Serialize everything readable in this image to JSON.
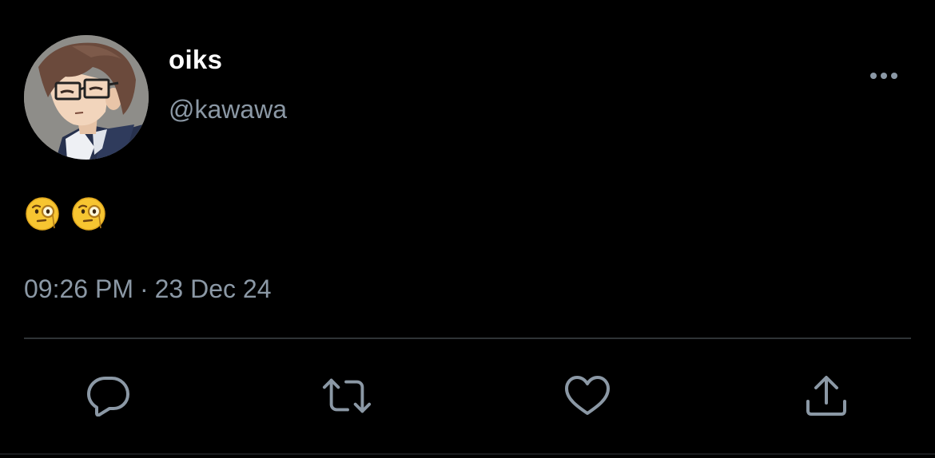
{
  "tweet": {
    "author": {
      "display_name": "oiks",
      "handle": "@kawawa"
    },
    "body": {
      "emojis": [
        "face-with-monocle",
        "face-with-monocle"
      ]
    },
    "meta": {
      "time": "09:26 PM",
      "separator": "·",
      "date": "23 Dec 24"
    },
    "actions": [
      {
        "name": "reply",
        "icon": "reply-icon"
      },
      {
        "name": "retweet",
        "icon": "retweet-icon"
      },
      {
        "name": "like",
        "icon": "heart-icon"
      },
      {
        "name": "share",
        "icon": "share-icon"
      }
    ]
  },
  "theme": {
    "background": "#000000",
    "primary_text": "#ffffff",
    "secondary_text": "#8b98a5",
    "divider": "#2f3336",
    "icon": "#8b98a5"
  }
}
